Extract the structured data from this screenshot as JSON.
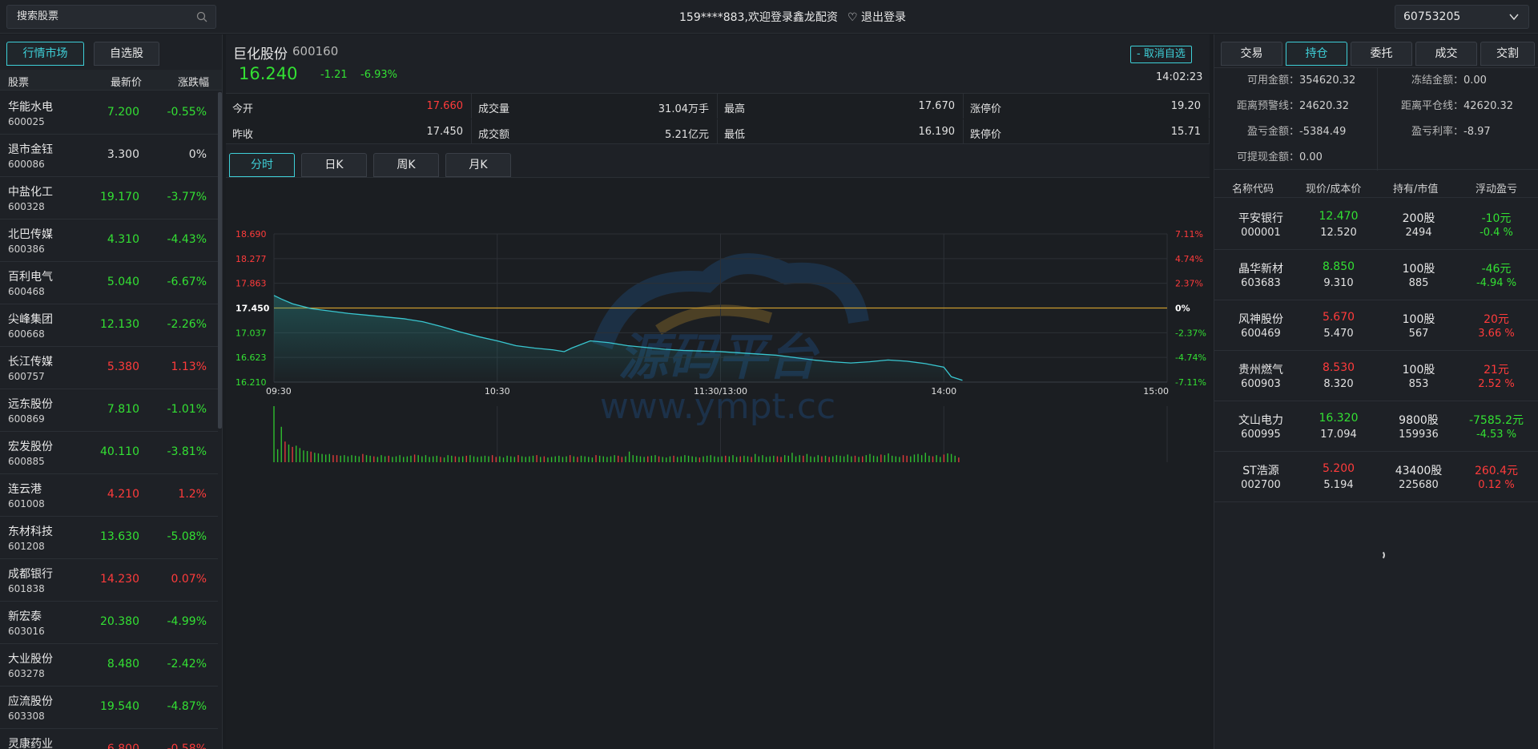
{
  "header": {
    "search_placeholder": "搜索股票",
    "welcome": "159****883,欢迎登录鑫龙配资",
    "logout_label": "退出登录",
    "account_id": "60753205"
  },
  "market": {
    "tabs": [
      "行情市场",
      "自选股"
    ],
    "columns": [
      "股票",
      "最新价",
      "涨跌幅"
    ],
    "stocks": [
      {
        "name": "华能水电",
        "code": "600025",
        "price": "7.200",
        "pct": "-0.55%",
        "dir": "down"
      },
      {
        "name": "退市金钰",
        "code": "600086",
        "price": "3.300",
        "pct": "0%",
        "dir": "flat"
      },
      {
        "name": "中盐化工",
        "code": "600328",
        "price": "19.170",
        "pct": "-3.77%",
        "dir": "down"
      },
      {
        "name": "北巴传媒",
        "code": "600386",
        "price": "4.310",
        "pct": "-4.43%",
        "dir": "down"
      },
      {
        "name": "百利电气",
        "code": "600468",
        "price": "5.040",
        "pct": "-6.67%",
        "dir": "down"
      },
      {
        "name": "尖峰集团",
        "code": "600668",
        "price": "12.130",
        "pct": "-2.26%",
        "dir": "down"
      },
      {
        "name": "长江传媒",
        "code": "600757",
        "price": "5.380",
        "pct": "1.13%",
        "dir": "up"
      },
      {
        "name": "远东股份",
        "code": "600869",
        "price": "7.810",
        "pct": "-1.01%",
        "dir": "down"
      },
      {
        "name": "宏发股份",
        "code": "600885",
        "price": "40.110",
        "pct": "-3.81%",
        "dir": "down"
      },
      {
        "name": "连云港",
        "code": "601008",
        "price": "4.210",
        "pct": "1.2%",
        "dir": "up"
      },
      {
        "name": "东材科技",
        "code": "601208",
        "price": "13.630",
        "pct": "-5.08%",
        "dir": "down"
      },
      {
        "name": "成都银行",
        "code": "601838",
        "price": "14.230",
        "pct": "0.07%",
        "dir": "up"
      },
      {
        "name": "新宏泰",
        "code": "603016",
        "price": "20.380",
        "pct": "-4.99%",
        "dir": "down"
      },
      {
        "name": "大业股份",
        "code": "603278",
        "price": "8.480",
        "pct": "-2.42%",
        "dir": "down"
      },
      {
        "name": "应流股份",
        "code": "603308",
        "price": "19.540",
        "pct": "-4.87%",
        "dir": "down"
      },
      {
        "name": "灵康药业",
        "code": "",
        "price": "6.800",
        "pct": "-0.58%",
        "dir": "up"
      }
    ]
  },
  "quote": {
    "name": "巨化股份",
    "code": "600160",
    "price": "16.240",
    "change": "-1.21",
    "change_pct": "-6.93%",
    "unfav_label": "- 取消自选",
    "time": "14:02:23",
    "fields": [
      {
        "label": "今开",
        "value": "17.660",
        "dir": "up"
      },
      {
        "label": "成交量",
        "value": "31.04万手",
        "dir": "flat"
      },
      {
        "label": "最高",
        "value": "17.670",
        "dir": "flat"
      },
      {
        "label": "涨停价",
        "value": "19.20",
        "dir": "flat"
      },
      {
        "label": "昨收",
        "value": "17.450",
        "dir": "flat"
      },
      {
        "label": "成交额",
        "value": "5.21亿元",
        "dir": "flat"
      },
      {
        "label": "最低",
        "value": "16.190",
        "dir": "flat"
      },
      {
        "label": "跌停价",
        "value": "15.71",
        "dir": "flat"
      }
    ],
    "chart_tabs": [
      "分时",
      "日K",
      "周K",
      "月K"
    ]
  },
  "chart_data": {
    "type": "line",
    "prev_close": 17.45,
    "y_ticks": [
      "18.690",
      "18.277",
      "17.863",
      "17.450",
      "17.037",
      "16.623",
      "16.210"
    ],
    "pct_ticks": [
      "7.11%",
      "4.74%",
      "2.37%",
      "0%",
      "-2.37%",
      "-4.74%",
      "-7.11%"
    ],
    "x_ticks": [
      "09:30",
      "10:30",
      "11:30/13:00",
      "14:00",
      "15:00"
    ],
    "ylim": [
      16.21,
      18.69
    ],
    "session_minutes": 240,
    "price_points": [
      [
        0,
        17.66
      ],
      [
        2,
        17.6
      ],
      [
        5,
        17.52
      ],
      [
        10,
        17.44
      ],
      [
        15,
        17.4
      ],
      [
        20,
        17.36
      ],
      [
        25,
        17.33
      ],
      [
        30,
        17.3
      ],
      [
        35,
        17.27
      ],
      [
        40,
        17.22
      ],
      [
        45,
        17.14
      ],
      [
        50,
        17.05
      ],
      [
        55,
        16.97
      ],
      [
        60,
        16.9
      ],
      [
        65,
        16.82
      ],
      [
        70,
        16.78
      ],
      [
        75,
        16.75
      ],
      [
        78,
        16.72
      ],
      [
        80,
        16.78
      ],
      [
        85,
        16.9
      ],
      [
        90,
        16.87
      ],
      [
        95,
        16.82
      ],
      [
        100,
        16.79
      ],
      [
        105,
        16.76
      ],
      [
        110,
        16.74
      ],
      [
        115,
        16.73
      ],
      [
        120,
        16.72
      ],
      [
        125,
        16.7
      ],
      [
        130,
        16.68
      ],
      [
        135,
        16.66
      ],
      [
        140,
        16.62
      ],
      [
        145,
        16.58
      ],
      [
        150,
        16.55
      ],
      [
        155,
        16.53
      ],
      [
        160,
        16.55
      ],
      [
        165,
        16.58
      ],
      [
        170,
        16.56
      ],
      [
        175,
        16.52
      ],
      [
        180,
        16.46
      ],
      [
        182,
        16.3
      ],
      [
        185,
        16.24
      ]
    ],
    "volume": [
      95,
      22,
      60,
      35,
      30,
      26,
      28,
      24,
      20,
      19,
      18,
      16,
      15,
      14,
      13,
      14,
      12,
      12,
      11,
      12,
      10,
      12,
      11,
      10,
      14,
      12,
      11,
      10,
      9,
      12,
      10,
      11,
      9,
      10,
      12,
      9,
      10,
      11,
      13,
      12,
      10,
      12,
      9,
      10,
      11,
      9,
      8,
      12,
      11,
      10,
      9,
      10,
      11,
      12,
      10,
      9,
      10,
      11,
      10,
      12,
      9,
      10,
      8,
      11,
      10,
      9,
      12,
      10,
      9,
      10,
      11,
      12,
      9,
      10,
      8,
      9,
      10,
      11,
      9,
      10,
      12,
      10,
      9,
      11,
      10,
      9,
      8,
      12,
      11,
      10,
      9,
      10,
      12,
      11,
      9,
      10,
      18,
      12,
      11,
      10,
      9,
      10,
      11,
      12,
      10,
      9,
      8,
      10,
      11,
      9,
      10,
      12,
      11,
      10,
      9,
      8,
      10,
      11,
      12,
      10,
      9,
      10,
      11,
      10,
      12,
      9,
      10,
      11,
      10,
      9,
      14,
      10,
      12,
      9,
      10,
      11,
      10,
      9,
      12,
      11,
      16,
      10,
      12,
      11,
      14,
      10,
      9,
      12,
      10,
      11,
      9,
      10,
      12,
      11,
      10,
      13,
      10,
      11,
      9,
      10,
      12,
      14,
      11,
      10,
      13,
      12,
      15,
      11,
      10,
      9,
      12,
      11,
      10,
      13,
      14,
      12,
      16,
      11,
      10,
      12,
      9,
      13,
      15,
      14,
      11,
      8
    ]
  },
  "account": {
    "tabs": [
      "交易",
      "持仓",
      "委托",
      "成交",
      "交割"
    ],
    "info": [
      {
        "label": "可用金额：",
        "value": "354620.32"
      },
      {
        "label": "冻结金额：",
        "value": "0.00"
      },
      {
        "label": "距离预警线：",
        "value": "24620.32"
      },
      {
        "label": "距离平仓线：",
        "value": "42620.32"
      },
      {
        "label": "盈亏金额：",
        "value": "-5384.49"
      },
      {
        "label": "盈亏利率：",
        "value": "-8.97"
      },
      {
        "label": "可提现金额：",
        "value": "0.00"
      }
    ],
    "hold_columns": [
      "名称代码",
      "现价/成本价",
      "持有/市值",
      "浮动盈亏"
    ],
    "holdings": [
      {
        "name": "平安银行",
        "code": "000001",
        "price": "12.470",
        "cost": "12.520",
        "qty": "200股",
        "value": "2494",
        "pl": "-10元",
        "plp": "-0.4 %",
        "pdir": "down",
        "dir": "down"
      },
      {
        "name": "晶华新材",
        "code": "603683",
        "price": "8.850",
        "cost": "9.310",
        "qty": "100股",
        "value": "885",
        "pl": "-46元",
        "plp": "-4.94 %",
        "pdir": "down",
        "dir": "down"
      },
      {
        "name": "风神股份",
        "code": "600469",
        "price": "5.670",
        "cost": "5.470",
        "qty": "100股",
        "value": "567",
        "pl": "20元",
        "plp": "3.66 %",
        "pdir": "up",
        "dir": "up"
      },
      {
        "name": "贵州燃气",
        "code": "600903",
        "price": "8.530",
        "cost": "8.320",
        "qty": "100股",
        "value": "853",
        "pl": "21元",
        "plp": "2.52 %",
        "pdir": "up",
        "dir": "up"
      },
      {
        "name": "文山电力",
        "code": "600995",
        "price": "16.320",
        "cost": "17.094",
        "qty": "9800股",
        "value": "159936",
        "pl": "-7585.2元",
        "plp": "-4.53 %",
        "pdir": "down",
        "dir": "down"
      },
      {
        "name": "ST浩源",
        "code": "002700",
        "price": "5.200",
        "cost": "5.194",
        "qty": "43400股",
        "value": "225680",
        "pl": "260.4元",
        "plp": "0.12 %",
        "pdir": "up",
        "dir": "up"
      }
    ]
  },
  "watermark": {
    "text_cn": "源码平台",
    "text_url": "www.ympt.cc"
  }
}
